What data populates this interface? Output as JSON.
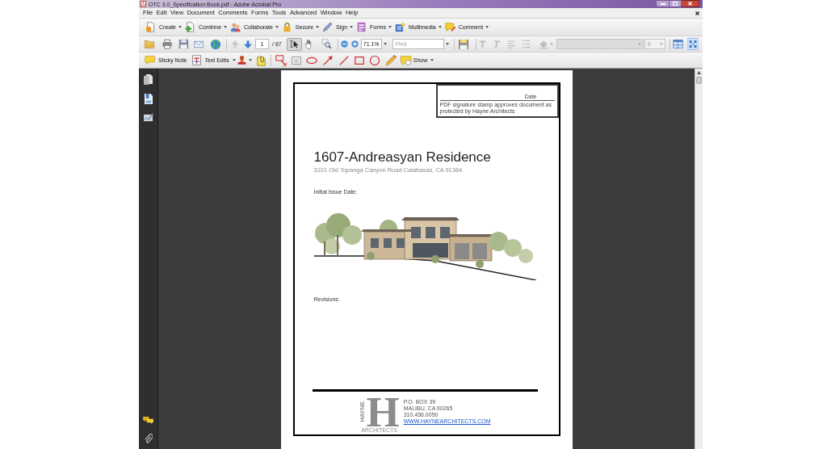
{
  "window": {
    "title": "OTC 3.0_Specification Book.pdf - Adobe Acrobat Pro"
  },
  "menu": [
    "File",
    "Edit",
    "View",
    "Document",
    "Comments",
    "Forms",
    "Tools",
    "Advanced",
    "Window",
    "Help"
  ],
  "task_toolbar": [
    "Create",
    "Combine",
    "Collaborate",
    "Secure",
    "Sign",
    "Forms",
    "Multimedia",
    "Comment"
  ],
  "navigation_toolbar": {
    "page_buttons": [
      {
        "disabled": true
      },
      {
        "disabled": false
      }
    ],
    "page_number": "1",
    "page_count": "/ 67",
    "tools": [
      {
        "selected": true
      },
      {
        "selected": false
      },
      {
        "selected": false
      }
    ],
    "zoom": "71.1%",
    "find": {
      "placeholder": "Find"
    },
    "format_tools": {
      "disabled": true
    },
    "font_size": "9"
  },
  "comment_toolbar": {
    "sticky_note": "Sticky Note",
    "text_edits": "Text Edits",
    "show": "Show"
  },
  "document": {
    "signature_box": {
      "date_label": "Date",
      "note": "PDF signature stamp approves document as protected by Hayne Architects"
    },
    "title": "1607-Andreasyan Residence",
    "address": "3101 Old Topanga Canyon Road Calabasas, CA 91364",
    "issue_label": "Initial Issue Date:",
    "revisions_label": "Revisions:",
    "footer": {
      "logo_letter": "H",
      "logo_name": "HAYNE",
      "logo_subtitle": "ARCHITECTS",
      "contact_lines": [
        "P.O. BOX 39",
        "MALIBU, CA 90265",
        "310.456.0050"
      ],
      "website": "WWW.HAYNEARCHITECTS.COM"
    }
  }
}
